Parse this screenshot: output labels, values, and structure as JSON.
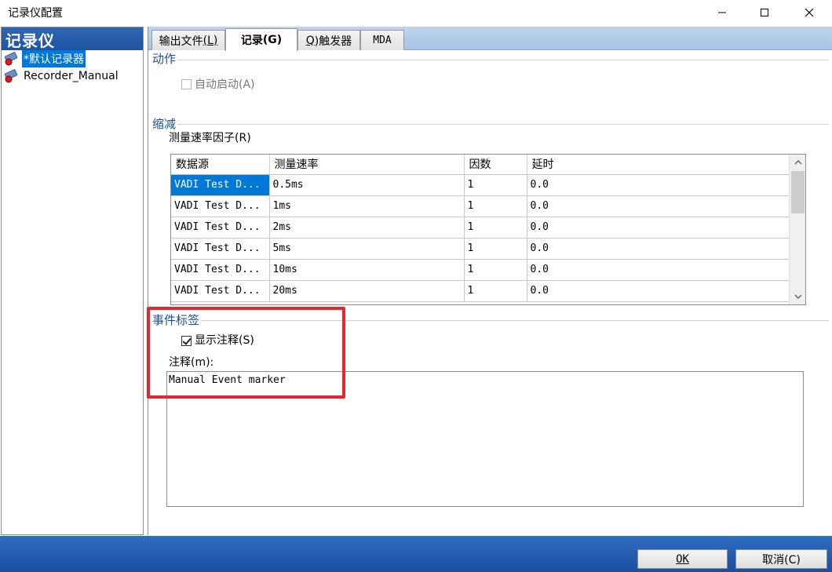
{
  "window": {
    "title": "记录仪配置"
  },
  "sidebar": {
    "header": "记录仪",
    "items": [
      {
        "label": "*默认记录器",
        "selected": true,
        "icon": "recorder-icon"
      },
      {
        "label": "Recorder_Manual",
        "selected": false,
        "icon": "recorder-icon"
      }
    ]
  },
  "tabs": [
    {
      "label": "输出文件",
      "mnemonic": "(L)",
      "active": false
    },
    {
      "label": "记录",
      "mnemonic": "(G)",
      "active": true
    },
    {
      "label_prefix": "Q",
      "label": ")触发器",
      "active": false
    },
    {
      "label": "MDA",
      "active": false
    }
  ],
  "action_group": {
    "title": "动作",
    "autostart_label": "自动启动(A)",
    "autostart_checked": false,
    "autostart_enabled": false
  },
  "reduction_group": {
    "title": "缩减",
    "factor_label": "测量速率因子(R)",
    "columns": [
      "数据源",
      "测量速率",
      "因数",
      "延时"
    ],
    "rows": [
      [
        "VADI Test D...",
        "0.5ms",
        "1",
        "0.0"
      ],
      [
        "VADI Test D...",
        "1ms",
        "1",
        "0.0"
      ],
      [
        "VADI Test D...",
        "2ms",
        "1",
        "0.0"
      ],
      [
        "VADI Test D...",
        "5ms",
        "1",
        "0.0"
      ],
      [
        "VADI Test D...",
        "10ms",
        "1",
        "0.0"
      ],
      [
        "VADI Test D...",
        "20ms",
        "1",
        "0.0"
      ]
    ]
  },
  "event_group": {
    "title": "事件标签",
    "show_comment_label": "显示注释(S)",
    "show_comment_checked": true,
    "comment_label": "注释(m):",
    "comment_value": "Manual Event marker"
  },
  "buttons": {
    "ok": "OK",
    "cancel": "取消(C)"
  },
  "colors": {
    "accent": "#0078d7",
    "group_title": "#1f4e96",
    "highlight": "#e3262f",
    "bar_blue": "#1b4f9f"
  }
}
